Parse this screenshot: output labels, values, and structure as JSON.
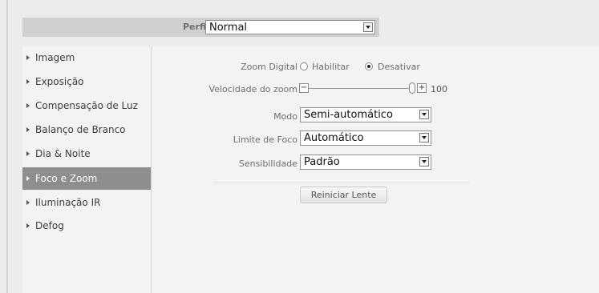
{
  "header": {
    "profile_label": "Perfil",
    "profile_value": "Normal"
  },
  "sidebar": {
    "items": [
      {
        "label": "Imagem"
      },
      {
        "label": "Exposição"
      },
      {
        "label": "Compensação de Luz"
      },
      {
        "label": "Balanço de Branco"
      },
      {
        "label": "Dia & Noite"
      },
      {
        "label": "Foco e Zoom",
        "active": true
      },
      {
        "label": "Iluminação IR"
      },
      {
        "label": "Defog"
      }
    ]
  },
  "main": {
    "zoom_digital": {
      "label": "Zoom Digital",
      "option_enable": "Habilitar",
      "option_disable": "Desativar",
      "selected": "Desativar"
    },
    "zoom_speed": {
      "label": "Velocidade do zoom",
      "minus": "−",
      "plus": "+",
      "value": "100",
      "fraction": 1.0
    },
    "mode": {
      "label": "Modo",
      "value": "Semi-automático"
    },
    "focus_limit": {
      "label": "Limite de Foco",
      "value": "Automático"
    },
    "sensitivity": {
      "label": "Sensibilidade",
      "value": "Padrão"
    },
    "reset_button": "Reiniciar Lente"
  },
  "colors": {
    "active_nav_bg": "#8e8e8e",
    "header_bg": "#d0d0d0",
    "panel_bg": "#f3f3f3"
  }
}
